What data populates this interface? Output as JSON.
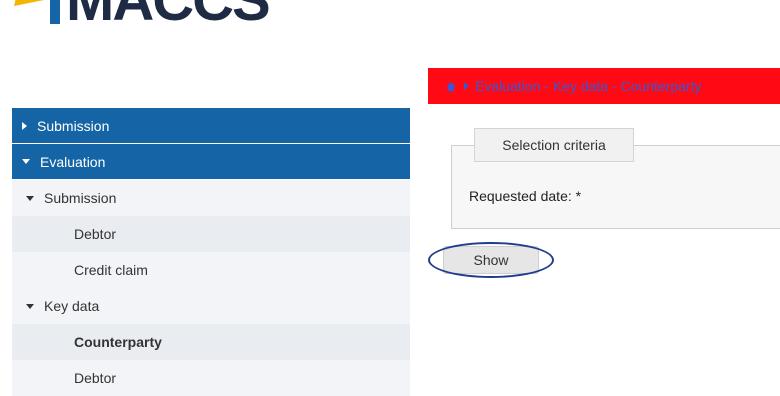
{
  "logo": {
    "text": "MACCS"
  },
  "breadcrumb": {
    "text": "Evaluation - Key data - Counterparty"
  },
  "sidebar": {
    "items": [
      {
        "label": "Submission"
      },
      {
        "label": "Evaluation"
      },
      {
        "label": "Submission"
      },
      {
        "label": "Debtor"
      },
      {
        "label": "Credit claim"
      },
      {
        "label": "Key data"
      },
      {
        "label": "Counterparty"
      },
      {
        "label": "Debtor"
      }
    ]
  },
  "form": {
    "legend": "Selection criteria",
    "requested_date_label": "Requested date:  *",
    "show_button": "Show"
  },
  "colors": {
    "sidebar_blue": "#1565a6",
    "breadcrumb_red": "#ff0a14",
    "highlight_circle": "#1f3d8a"
  },
  "icons": [
    "home-icon",
    "chevron-right-icon",
    "caret-down-icon"
  ]
}
